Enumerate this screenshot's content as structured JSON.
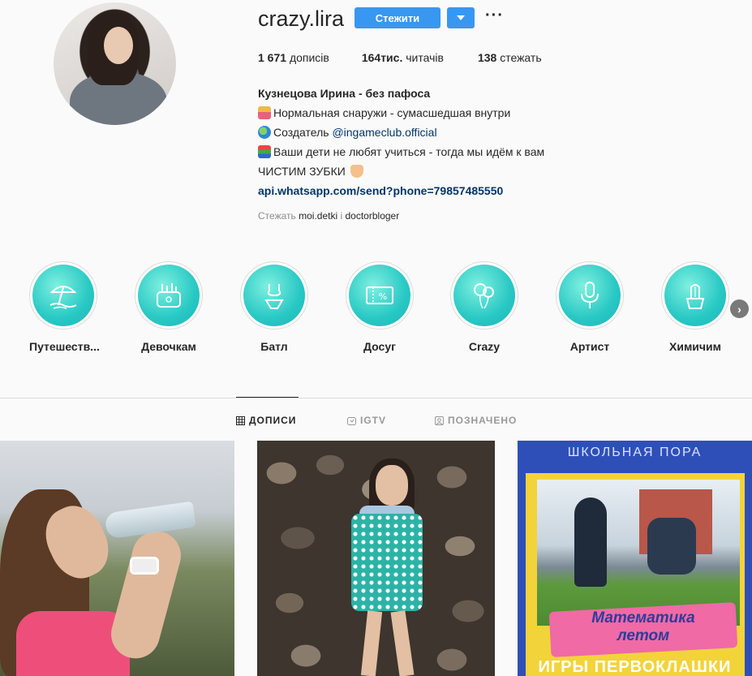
{
  "profile": {
    "username": "crazy.lira",
    "follow_label": "Стежити",
    "more_label": "···"
  },
  "stats": {
    "posts_value": "1 671",
    "posts_label": "дописів",
    "followers_value": "164тис.",
    "followers_label": "читачів",
    "following_value": "138",
    "following_label": "стежать"
  },
  "bio": {
    "name": "Кузнецова Ирина - без пафоса",
    "line1": "Нормальная снаружи - сумасшедшая внутри",
    "line2_prefix": "Создатель ",
    "line2_mention": "@ingameclub.official",
    "line3": "Ваши дети не любят учиться - тогда мы идём к вам",
    "line4": "ЧИСТИМ ЗУБКИ",
    "link": "api.whatsapp.com/send?phone=79857485550",
    "followed_prefix": "Стежать",
    "followed_names": "moi.detki",
    "followed_sep": "і",
    "followed_names2": "doctorbloger"
  },
  "highlights": [
    {
      "label": "Путешеств...",
      "icon": "beach-umbrella-icon"
    },
    {
      "label": "Девочкам",
      "icon": "cosmetics-bag-icon"
    },
    {
      "label": "Батл",
      "icon": "swimsuit-icon"
    },
    {
      "label": "Досуг",
      "icon": "ticket-icon"
    },
    {
      "label": "Crazy",
      "icon": "balloons-icon"
    },
    {
      "label": "Артист",
      "icon": "microphone-icon"
    },
    {
      "label": "Химичим",
      "icon": "cactus-icon"
    }
  ],
  "tabs": [
    {
      "label": "ДОПИСИ",
      "icon": "grid-icon",
      "active": true
    },
    {
      "label": "IGTV",
      "icon": "tv-icon",
      "active": false
    },
    {
      "label": "ПОЗНАЧЕНО",
      "icon": "tagged-icon",
      "active": false
    }
  ],
  "posts": {
    "p3_title": "ШКОЛЬНАЯ ПОРА",
    "p3_pink_line1": "Математика",
    "p3_pink_line2": "летом",
    "p3_bottom": "ИГРЫ ПЕРВОКЛАШКИ"
  },
  "colors": {
    "accent": "#3897f0",
    "link": "#003569",
    "highlight_fill": "#28c8c4"
  }
}
